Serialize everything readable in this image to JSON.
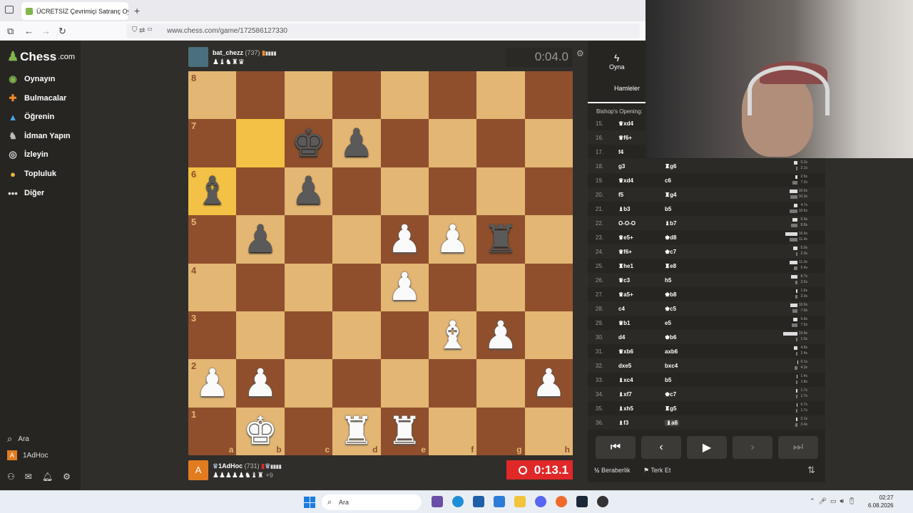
{
  "browser": {
    "tab_title": "ÜCRETSİZ Çevrimiçi Satranç Oy",
    "url": "www.chess.com/game/172586127330"
  },
  "site": {
    "logo_text": "Chess",
    "logo_suffix": ".com"
  },
  "sidebar": {
    "items": [
      {
        "label": "Oynayın",
        "icon": "play-icon"
      },
      {
        "label": "Bulmacalar",
        "icon": "puzzle-icon"
      },
      {
        "label": "Öğrenin",
        "icon": "learn-icon"
      },
      {
        "label": "İdman Yapın",
        "icon": "train-icon"
      },
      {
        "label": "İzleyin",
        "icon": "watch-icon"
      },
      {
        "label": "Topluluk",
        "icon": "community-icon"
      },
      {
        "label": "Diğer",
        "icon": "more-icon"
      }
    ],
    "search": "Ara",
    "user": "1AdHoc",
    "user_initial": "A"
  },
  "top_player": {
    "name": "bat_chezz",
    "rating": "(737)",
    "captured": "♟♝♞♜♛",
    "clock": "0:04.0"
  },
  "bottom_player": {
    "name": "1AdHoc",
    "rating": "(731)",
    "captured": "♟♟♟♟♟♞♝♜",
    "advantage": "+9",
    "initial": "A",
    "clock": "0:13.1"
  },
  "board": {
    "files": [
      "a",
      "b",
      "c",
      "d",
      "e",
      "f",
      "g",
      "h"
    ],
    "ranks": [
      "8",
      "7",
      "6",
      "5",
      "4",
      "3",
      "2",
      "1"
    ],
    "highlight": [
      "b7",
      "a6"
    ],
    "pieces": {
      "c7": "bk",
      "d7": "bp",
      "a6": "bb",
      "c6": "bp",
      "b5": "bp",
      "e5": "wp",
      "f5": "wp",
      "g5": "br",
      "e4": "wp",
      "f3": "wb",
      "g3": "wp",
      "a2": "wp",
      "b2": "wp",
      "h2": "wp",
      "b1": "wk",
      "d1": "wr",
      "e1": "wr"
    }
  },
  "panel": {
    "play_tab": "Oyna",
    "moves_tab": "Hamleler",
    "opening": "Bishop's Opening:",
    "moves": [
      {
        "n": "15.",
        "w": "♛xd4",
        "b": "",
        "wt": "",
        "bt": ""
      },
      {
        "n": "16.",
        "w": "♛f6+",
        "b": "",
        "wt": "",
        "bt": ""
      },
      {
        "n": "17.",
        "w": "f4",
        "b": "",
        "wt": "",
        "bt": ""
      },
      {
        "n": "18.",
        "w": "g3",
        "b": "♜g6",
        "wt": "5.2s",
        "bt": "2.1s",
        "ww": 0.26,
        "bw": 0.11
      },
      {
        "n": "19.",
        "w": "♛xd4",
        "b": "c6",
        "wt": "2.5s",
        "bt": "7.2s",
        "ww": 0.13,
        "bw": 0.36
      },
      {
        "n": "20.",
        "w": "f5",
        "b": "♜g4",
        "wt": "10.6s",
        "bt": "10.3s",
        "ww": 0.53,
        "bw": 0.52
      },
      {
        "n": "21.",
        "w": "♝b3",
        "b": "b5",
        "wt": "4.7s",
        "bt": "10.6s",
        "ww": 0.24,
        "bw": 0.53
      },
      {
        "n": "22.",
        "w": "O-O-O",
        "b": "♝b7",
        "wt": "6.9s",
        "bt": "8.8s",
        "ww": 0.35,
        "bw": 0.44
      },
      {
        "n": "23.",
        "w": "♛e5+",
        "b": "♚d8",
        "wt": "16.6s",
        "bt": "11.4s",
        "ww": 0.83,
        "bw": 0.57
      },
      {
        "n": "24.",
        "w": "♛f6+",
        "b": "♚c7",
        "wt": "5.9s",
        "bt": "2.3s",
        "ww": 0.3,
        "bw": 0.12
      },
      {
        "n": "25.",
        "w": "♜he1",
        "b": "♜e8",
        "wt": "11.3s",
        "bt": "5.4s",
        "ww": 0.57,
        "bw": 0.27
      },
      {
        "n": "26.",
        "w": "♛c3",
        "b": "h5",
        "wt": "8.7s",
        "bt": "2.5s",
        "ww": 0.44,
        "bw": 0.13
      },
      {
        "n": "27.",
        "w": "♛a5+",
        "b": "♚b8",
        "wt": "1.6s",
        "bt": "3.0s",
        "ww": 0.08,
        "bw": 0.15
      },
      {
        "n": "28.",
        "w": "c4",
        "b": "♚c5",
        "wt": "10.0s",
        "bt": "7.0s",
        "ww": 0.5,
        "bw": 0.35
      },
      {
        "n": "29.",
        "w": "♛b1",
        "b": "e5",
        "wt": "5.8s",
        "bt": "7.5s",
        "ww": 0.29,
        "bw": 0.38
      },
      {
        "n": "30.",
        "w": "d4",
        "b": "♚b6",
        "wt": "19.9s",
        "bt": "1.5s",
        "ww": 1.0,
        "bw": 0.08
      },
      {
        "n": "31.",
        "w": "♛xb6",
        "b": "axb6",
        "wt": "4.8s",
        "bt": "2.4s",
        "ww": 0.24,
        "bw": 0.12
      },
      {
        "n": "32.",
        "w": "dxe5",
        "b": "bxc4",
        "wt": "0.1s",
        "bt": "4.3s",
        "ww": 0.02,
        "bw": 0.22
      },
      {
        "n": "33.",
        "w": "♝xc4",
        "b": "b5",
        "wt": "1.4s",
        "bt": "1.8s",
        "ww": 0.07,
        "bw": 0.09
      },
      {
        "n": "34.",
        "w": "♝xf7",
        "b": "♚c7",
        "wt": "1.7s",
        "bt": "1.7s",
        "ww": 0.09,
        "bw": 0.09
      },
      {
        "n": "35.",
        "w": "♝xh5",
        "b": "♜g5",
        "wt": "0.7s",
        "bt": "1.7s",
        "ww": 0.04,
        "bw": 0.09
      },
      {
        "n": "36.",
        "w": "♝f3",
        "b": "♝a6",
        "wt": "2.1s",
        "bt": "3.4s",
        "ww": 0.11,
        "bw": 0.17
      }
    ],
    "draw": "Beraberlik",
    "draw_prefix": "½",
    "resign": "Terk Et"
  },
  "taskbar": {
    "search": "Ara",
    "time": "02:27",
    "date": "6.08.2026"
  },
  "colors": {
    "light": "#e3b673",
    "dark": "#8f4f2c",
    "highlight": "#f2c145",
    "clock_low": "#e02828"
  }
}
